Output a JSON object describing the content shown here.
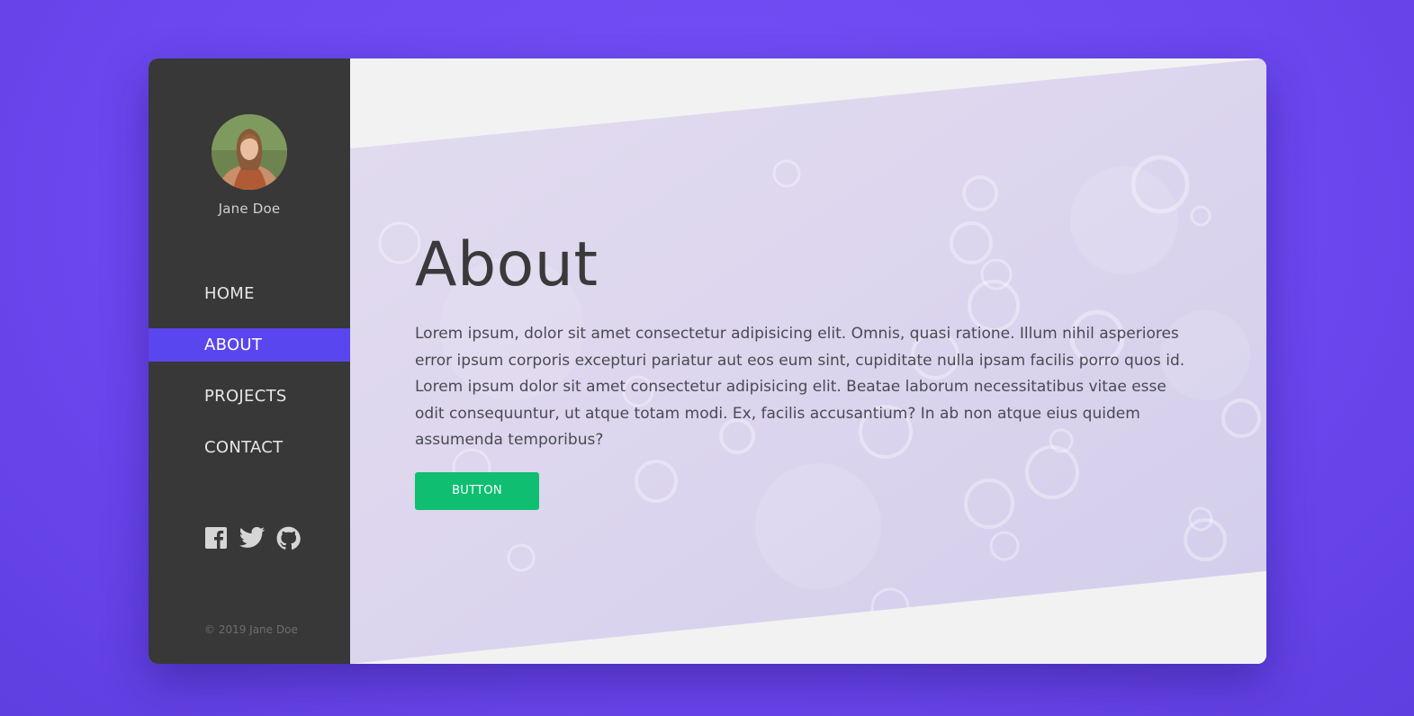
{
  "profile": {
    "name": "Jane Doe"
  },
  "nav": {
    "items": [
      {
        "label": "HOME"
      },
      {
        "label": "ABOUT"
      },
      {
        "label": "PROJECTS"
      },
      {
        "label": "CONTACT"
      }
    ],
    "active": "ABOUT"
  },
  "social": {
    "icons": [
      "facebook-icon",
      "twitter-icon",
      "github-icon"
    ]
  },
  "footer": {
    "copyright": "© 2019 Jane Doe"
  },
  "main": {
    "title": "About",
    "body": "Lorem ipsum, dolor sit amet consectetur adipisicing elit. Omnis, quasi ratione. Illum nihil asperiores error ipsum corporis excepturi pariatur aut eos eum sint, cupiditate nulla ipsam facilis porro quos id. Lorem ipsum dolor sit amet consectetur adipisicing elit. Beatae laborum necessitatibus vitae esse odit consequuntur, ut atque totam modi. Ex, facilis accusantium? In ab non atque eius quidem assumenda temporibus?",
    "button_label": "BUTTON"
  },
  "colors": {
    "page_background": "#6d4af2",
    "sidebar": "#383838",
    "active_nav": "#5a46ef",
    "button": "#0fbe71",
    "main_background": "#f3f2f3"
  }
}
